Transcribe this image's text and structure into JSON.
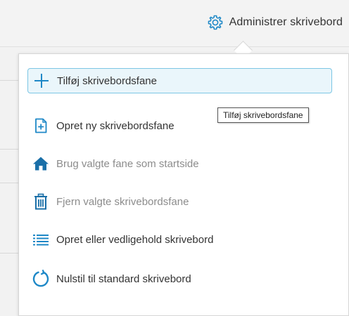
{
  "header": {
    "admin_label": "Administrer skrivebord",
    "admin_icon": "gear-icon"
  },
  "menu": {
    "items": [
      {
        "label": "Tilføj skrivebordsfane",
        "icon": "plus-icon",
        "state": "selected"
      },
      {
        "label": "Opret ny skrivebordsfane",
        "icon": "add-page-icon",
        "state": "enabled"
      },
      {
        "label": "Brug valgte fane som startside",
        "icon": "home-icon",
        "state": "disabled"
      },
      {
        "label": "Fjern valgte skrivebordsfane",
        "icon": "trash-icon",
        "state": "disabled"
      },
      {
        "label": "Opret eller vedligehold skrivebord",
        "icon": "list-icon",
        "state": "enabled"
      },
      {
        "label": "Nulstil til standard skrivebord",
        "icon": "reset-icon",
        "state": "enabled"
      }
    ]
  },
  "tooltip": {
    "text": "Tilføj skrivebordsfane"
  },
  "colors": {
    "accent": "#1e88c7",
    "selected_bg": "#eaf6fb",
    "selected_border": "#7cc6e4",
    "disabled_text": "#8c8c8c"
  }
}
